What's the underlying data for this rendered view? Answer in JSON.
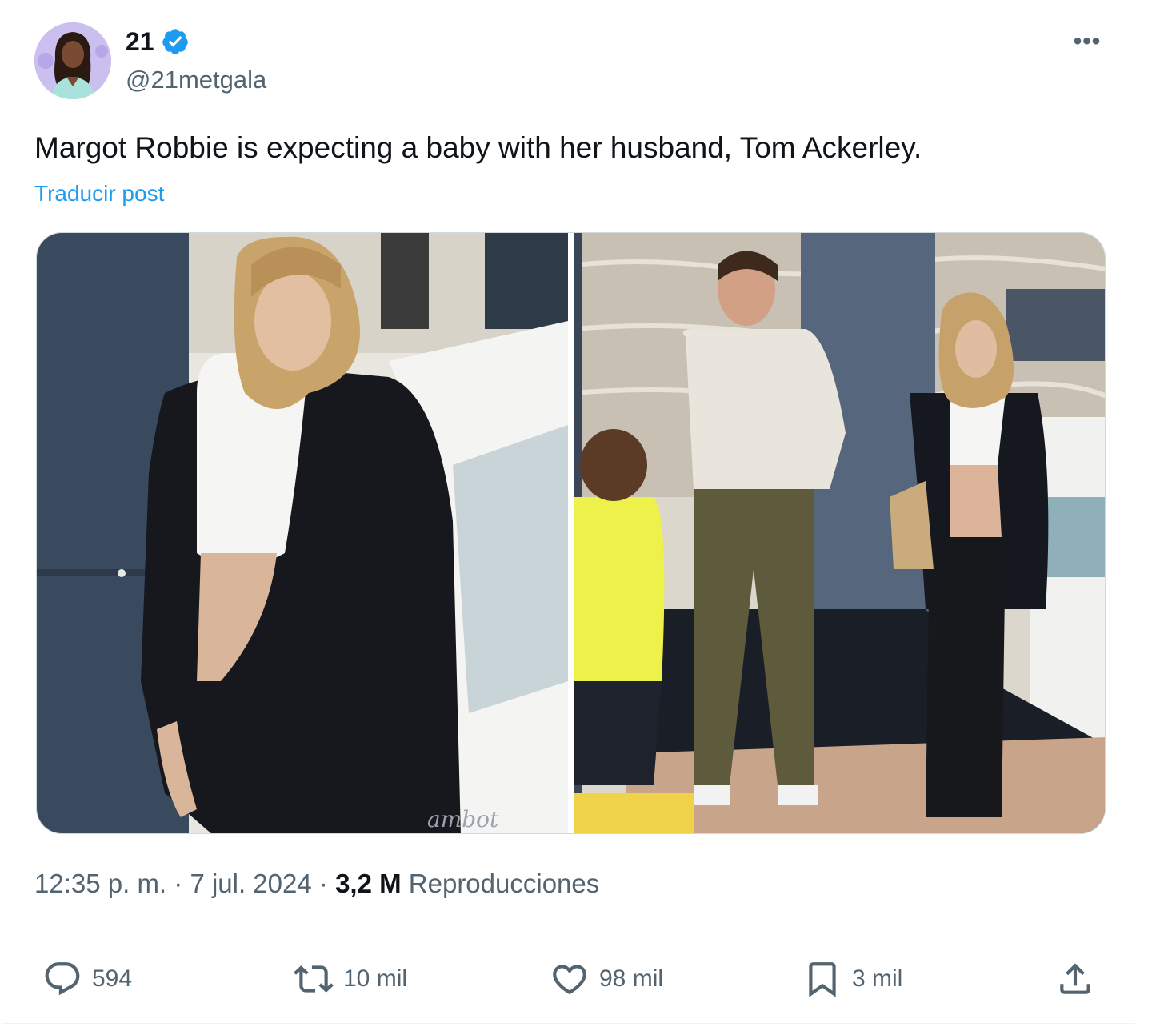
{
  "author": {
    "display_name": "21",
    "handle": "@21metgala",
    "verified_icon": "verified-badge-icon",
    "avatar_icon": "avatar-portrait"
  },
  "tweet": {
    "text": "Margot Robbie is expecting a baby with her husband, Tom Ackerley.",
    "translate_label": "Traducir post",
    "more_icon": "more-options-icon",
    "more_label": "•••"
  },
  "media": {
    "images": [
      {
        "description": "photo-left"
      },
      {
        "description": "photo-right"
      }
    ],
    "watermark": "ambot"
  },
  "meta": {
    "time": "12:35 p. m.",
    "separator": " · ",
    "date": "7 jul. 2024",
    "views_count": "3,2 M",
    "views_label": "Reproducciones"
  },
  "actions": {
    "reply": {
      "icon": "reply-icon",
      "count": "594"
    },
    "retweet": {
      "icon": "retweet-icon",
      "count": "10 mil"
    },
    "like": {
      "icon": "heart-icon",
      "count": "98 mil"
    },
    "bookmark": {
      "icon": "bookmark-icon",
      "count": "3 mil"
    },
    "share": {
      "icon": "share-icon"
    }
  },
  "colors": {
    "accent": "#1d9bf0",
    "text_primary": "#0f1419",
    "text_secondary": "#536471",
    "border": "#eff3f4"
  }
}
